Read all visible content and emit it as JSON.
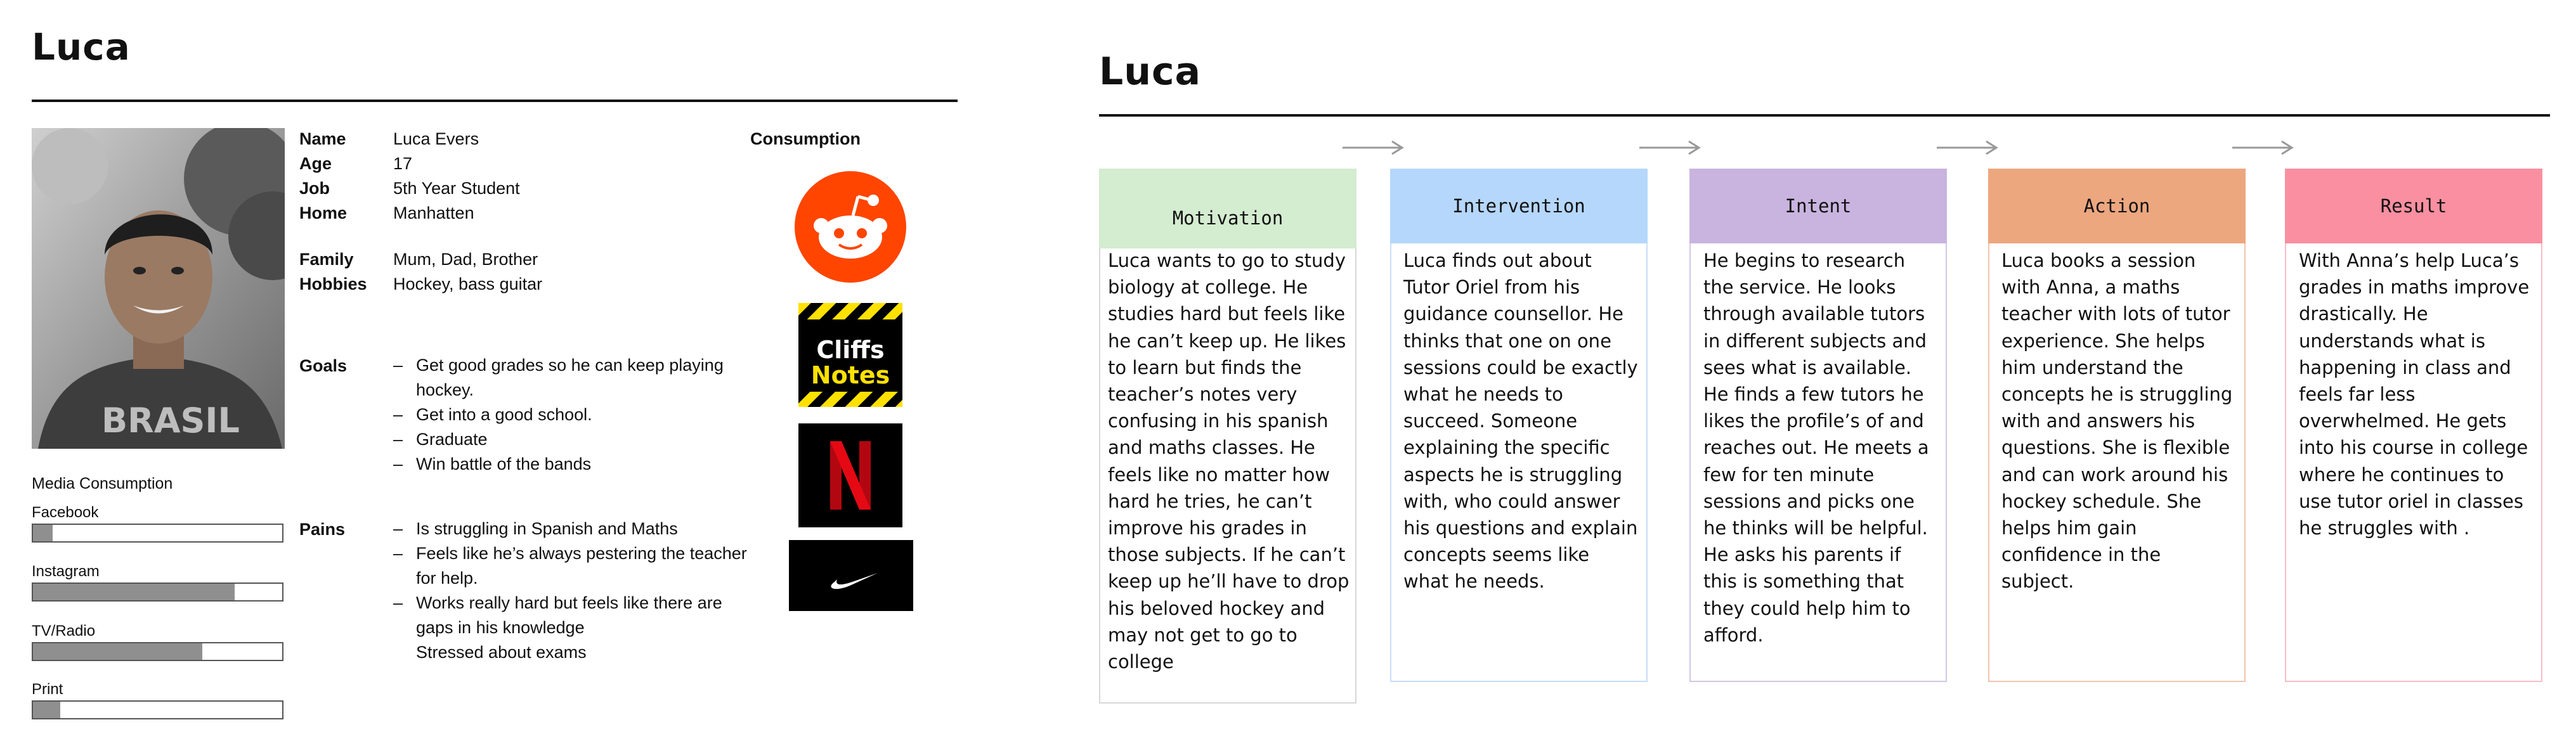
{
  "left_panel": {
    "title": "Luca",
    "profile": {
      "name_label": "Name",
      "name": "Luca Evers",
      "age_label": "Age",
      "age": "17",
      "job_label": "Job",
      "job": "5th Year Student",
      "home_label": "Home",
      "home": "Manhatten",
      "family_label": "Family",
      "family": "Mum, Dad, Brother",
      "hobbies_label": "Hobbies",
      "hobbies": "Hockey, bass guitar"
    },
    "goals_label": "Goals",
    "goals": [
      "Get good grades so he can keep playing hockey.",
      "Get into a good school.",
      "Graduate",
      "Win battle of the bands"
    ],
    "pains_label": "Pains",
    "pains": [
      "Is struggling in Spanish and Maths",
      "Feels like he’s always pestering the teacher for help.",
      "Works really hard but feels like there are gaps in his knowledge",
      "Stressed about exams"
    ],
    "media_title": "Media Consumption",
    "media": [
      {
        "label": "Facebook",
        "level": 0.08
      },
      {
        "label": "Instagram",
        "level": 0.81
      },
      {
        "label": "TV/Radio",
        "level": 0.68
      },
      {
        "label": "Print",
        "level": 0.11
      }
    ],
    "consumption_title": "Consumption",
    "brands": [
      {
        "name": "Reddit",
        "color": "#ff4500"
      },
      {
        "name": "CliffsNotes",
        "logo_text_1": "Cliffs",
        "logo_text_2": "Notes"
      },
      {
        "name": "Netflix",
        "color": "#e50914"
      },
      {
        "name": "Nike"
      }
    ]
  },
  "right_panel": {
    "title": "Luca",
    "stages": [
      {
        "label": "Motivation",
        "color": "#d4ecd0",
        "border": "#d8d8d8",
        "text": "Luca wants to go to study biology at college. He studies hard but feels like he can’t keep up. He likes to learn but finds the teacher’s notes very confusing in his spanish and maths classes. He feels like no matter how hard he tries, he can’t improve his grades in those subjects. If he can’t keep up he’ll have to drop his beloved hockey and may not get to go to college"
      },
      {
        "label": "Intervention",
        "color": "#b5d7fb",
        "border": "#c7defa",
        "text": "Luca finds out about Tutor Oriel from his guidance counsellor. He thinks that one on one sessions could be exactly what he needs to succeed. Someone explaining the specific aspects he is struggling with, who could answer his questions and explain concepts seems like what he needs."
      },
      {
        "label": "Intent",
        "color": "#c9b4df",
        "border": "#d2c6e6",
        "text": "He begins to research the service. He looks through available tutors in different subjects and sees what is available. He finds a few tutors he likes the profile’s of and reaches out. He meets a few for ten minute sessions and picks one he thinks will be helpful. He asks his parents if this is something that they could help him to afford."
      },
      {
        "label": "Action",
        "color": "#eca77f",
        "border": "#f0c4ad",
        "text": "Luca books a session with Anna, a maths teacher with lots of tutor experience. She helps him understand the concepts he is struggling with and answers his questions. She is flexible and can work around his hockey schedule. She helps him gain confidence in the subject."
      },
      {
        "label": "Result",
        "color": "#f98fa1",
        "border": "#f9bcc7",
        "text": "With Anna’s help Luca’s grades in maths improve drastically. He understands what is happening in class and feels far less overwhelmed. He gets into his course in college where he continues to use tutor oriel in classes he struggles with ."
      }
    ]
  }
}
